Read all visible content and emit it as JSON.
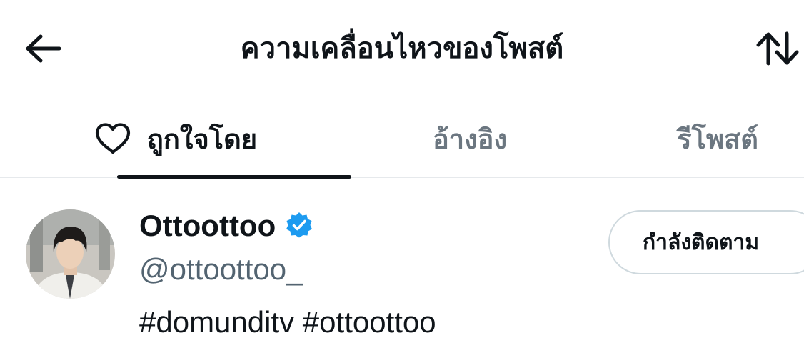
{
  "header": {
    "back_icon": "arrow-left-icon",
    "title": "ความเคลื่อนไหวของโพสต์",
    "sort_icon": "sort-arrows-icon"
  },
  "tabs": [
    {
      "label": "ถูกใจโดย",
      "icon": "heart-outline-icon",
      "active": true
    },
    {
      "label": "อ้างอิง",
      "active": false
    },
    {
      "label": "รีโพสต์",
      "active": false
    }
  ],
  "user": {
    "name": "Ottoottoo",
    "verified": true,
    "handle": "@ottoottoo_",
    "bio": "#domunditv #ottoottoo",
    "follow_button_label": "กำลังติดตาม"
  },
  "colors": {
    "text_primary": "#0f1419",
    "text_secondary": "#536471",
    "tab_inactive": "#6b7680",
    "verified_badge": "#1d9bf0",
    "divider": "#e6e9ec",
    "button_border": "#cfd9de"
  }
}
